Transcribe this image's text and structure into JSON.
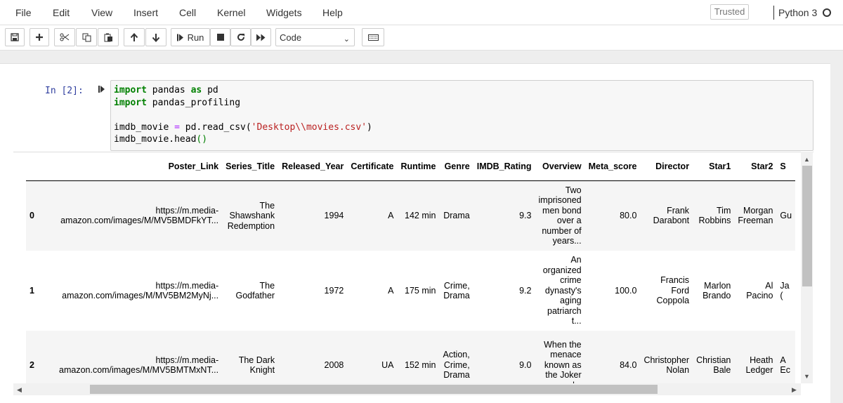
{
  "menu": [
    "File",
    "Edit",
    "View",
    "Insert",
    "Cell",
    "Kernel",
    "Widgets",
    "Help"
  ],
  "trusted_label": "Trusted",
  "kernel": {
    "name": "Python 3"
  },
  "toolbar": {
    "run_label": "Run",
    "cell_type": "Code",
    "icons": [
      "save-icon",
      "plus-icon",
      "cut-icon",
      "copy-icon",
      "paste-icon",
      "arrow-up-icon",
      "arrow-down-icon",
      "run-icon",
      "stop-icon",
      "restart-icon",
      "fast-forward-icon",
      "keyboard-icon"
    ]
  },
  "cell": {
    "prompt": "In [2]:",
    "code_lines": [
      [
        {
          "t": "import",
          "c": "kw"
        },
        {
          "t": " pandas "
        },
        {
          "t": "as",
          "c": "kw"
        },
        {
          "t": " pd"
        }
      ],
      [
        {
          "t": "import",
          "c": "kw"
        },
        {
          "t": " pandas_profiling"
        }
      ],
      [],
      [
        {
          "t": "imdb_movie "
        },
        {
          "t": "=",
          "c": "op"
        },
        {
          "t": " pd.read_csv("
        },
        {
          "t": "'Desktop\\\\movies.csv'",
          "c": "str"
        },
        {
          "t": ")"
        }
      ],
      [
        {
          "t": "imdb_movie.head"
        },
        {
          "t": "()",
          "c": "paren"
        }
      ]
    ]
  },
  "dataframe": {
    "columns": [
      "",
      "Poster_Link",
      "Series_Title",
      "Released_Year",
      "Certificate",
      "Runtime",
      "Genre",
      "IMDB_Rating",
      "Overview",
      "Meta_score",
      "Director",
      "Star1",
      "Star2",
      "S"
    ],
    "rows": [
      {
        "index": "0",
        "cells": [
          "https://m.media-\namazon.com/images/M/MV5BMDFkYT...",
          "The\nShawshank\nRedemption",
          "1994",
          "A",
          "142 min",
          "Drama",
          "9.3",
          "Two\nimprisoned\nmen bond\nover a\nnumber of\nyears...",
          "80.0",
          "Frank\nDarabont",
          "Tim\nRobbins",
          "Morgan\nFreeman",
          "Gu"
        ]
      },
      {
        "index": "1",
        "cells": [
          "https://m.media-\namazon.com/images/M/MV5BM2MyNj...",
          "The\nGodfather",
          "1972",
          "A",
          "175 min",
          "Crime,\nDrama",
          "9.2",
          "An\norganized\ncrime\ndynasty's\naging\npatriarch\nt...",
          "100.0",
          "Francis\nFord\nCoppola",
          "Marlon\nBrando",
          "Al\nPacino",
          "Ja\n("
        ]
      },
      {
        "index": "2",
        "cells": [
          "https://m.media-\namazon.com/images/M/MV5BMTMxNT...",
          "The Dark\nKnight",
          "2008",
          "UA",
          "152 min",
          "Action,\nCrime,\nDrama",
          "9.0",
          "When the\nmenace\nknown as\nthe Joker\nwreaks",
          "84.0",
          "Christopher\nNolan",
          "Christian\nBale",
          "Heath\nLedger",
          "A\nEc"
        ]
      }
    ]
  }
}
